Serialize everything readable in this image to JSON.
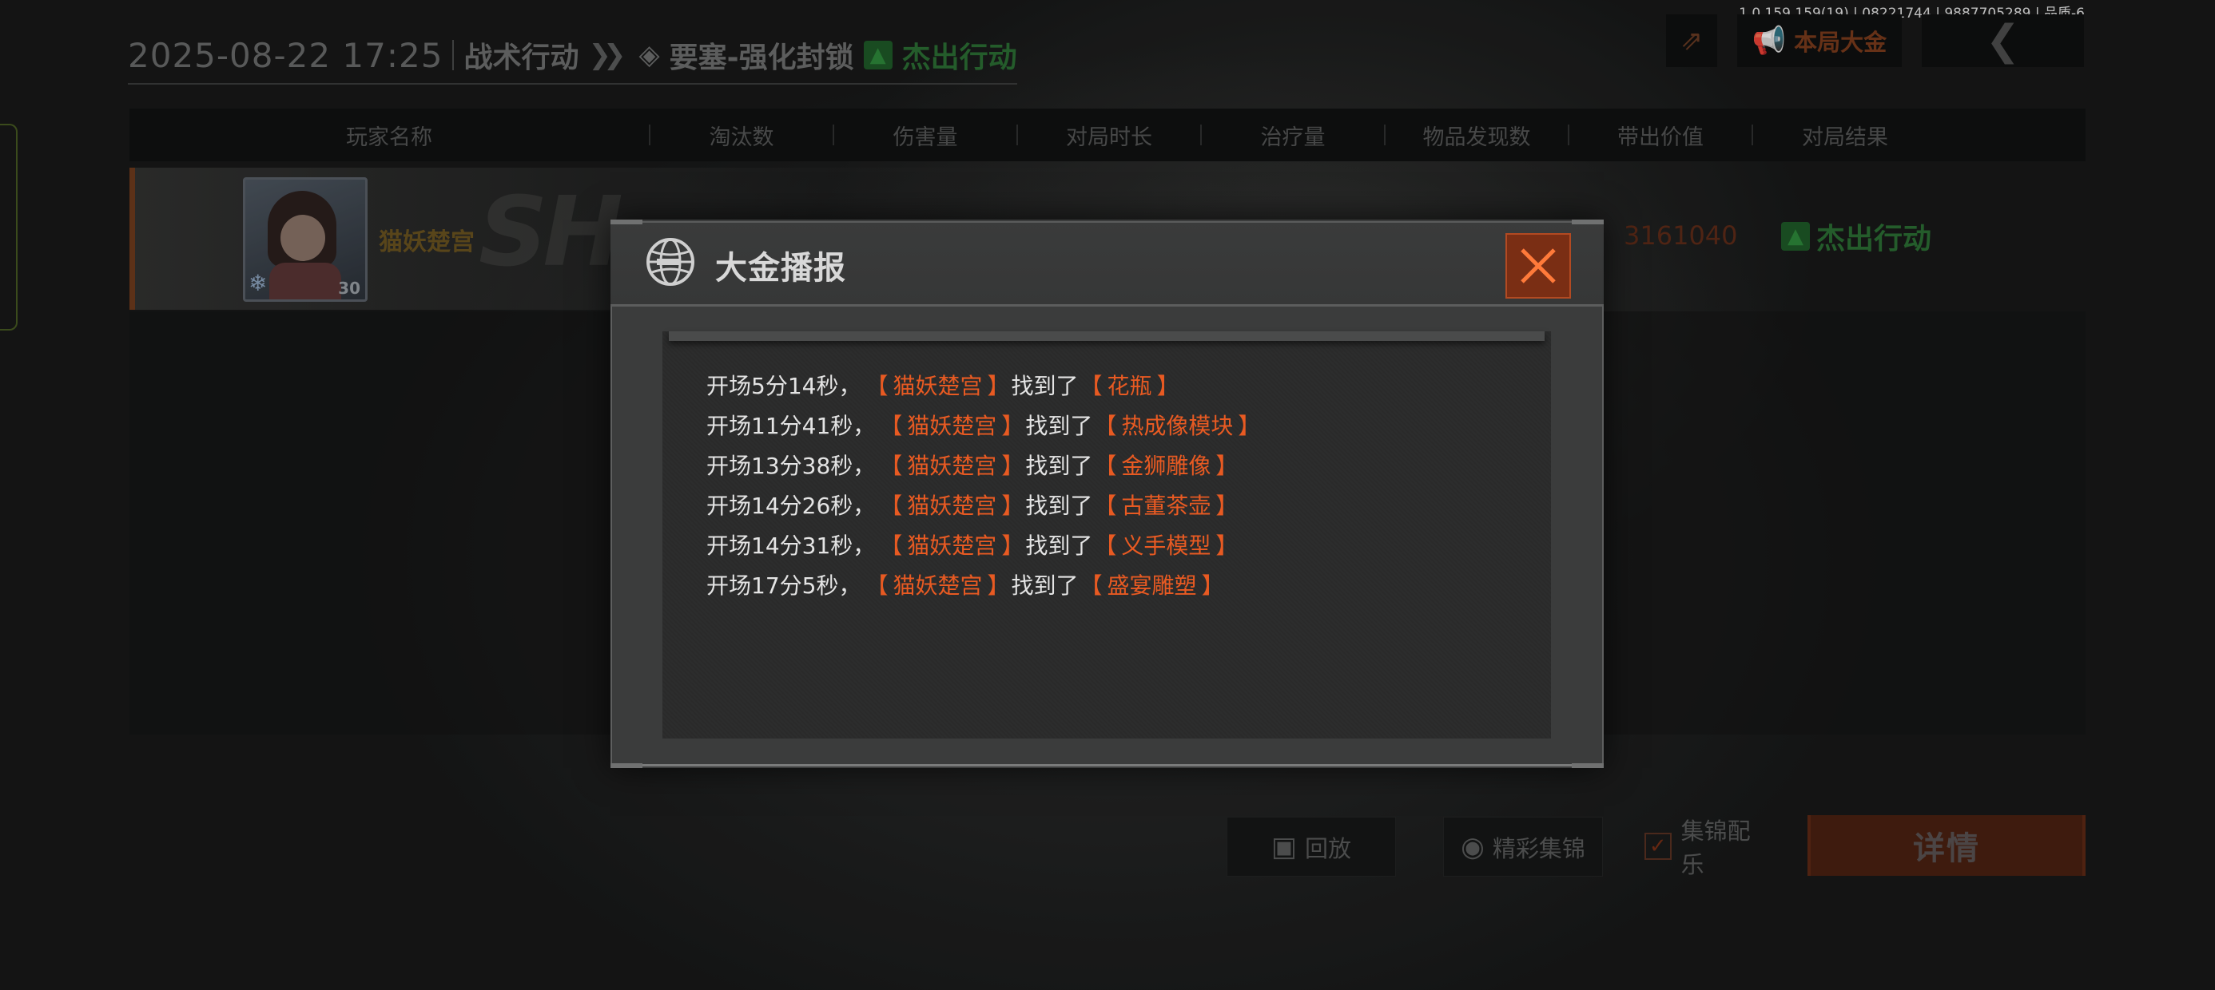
{
  "version_info": "1.0.159.159(19) | 08221744 | 9887705289 | 品质-6",
  "header": {
    "datetime": "2025-08-22 17:25",
    "mode": "战术行动",
    "map": "要塞-强化封锁",
    "result": "杰出行动"
  },
  "top_buttons": {
    "big_money_label": "本局大金"
  },
  "table": {
    "columns": [
      "玩家名称",
      "淘汰数",
      "伤害量",
      "对局时长",
      "治疗量",
      "物品发现数",
      "带出价值",
      "对局结果"
    ]
  },
  "player_row": {
    "name": "猫妖楚宫",
    "level": "30",
    "emblem_text": "SH",
    "value": "3161040",
    "result": "杰出行动"
  },
  "bottom_bar": {
    "replay_label": "回放",
    "highlights_label": "精彩集锦",
    "music_label": "集锦配乐",
    "music_checked": true,
    "details_label": "详情"
  },
  "modal": {
    "title": "大金播报",
    "found_text": "找到了",
    "reports": [
      {
        "time": "开场5分14秒",
        "player": "猫妖楚宫",
        "item": "花瓶"
      },
      {
        "time": "开场11分41秒",
        "player": "猫妖楚宫",
        "item": "热成像模块"
      },
      {
        "time": "开场13分38秒",
        "player": "猫妖楚宫",
        "item": "金狮雕像"
      },
      {
        "time": "开场14分26秒",
        "player": "猫妖楚宫",
        "item": "古董茶壶"
      },
      {
        "time": "开场14分31秒",
        "player": "猫妖楚宫",
        "item": "义手模型"
      },
      {
        "time": "开场17分5秒",
        "player": "猫妖楚宫",
        "item": "盛宴雕塑"
      }
    ]
  },
  "colors": {
    "accent_orange": "#e85a22",
    "close_button": "#7a2e14",
    "success_green": "#2a6e33"
  },
  "icons": {
    "share": "share-icon",
    "megaphone": "megaphone-icon",
    "back": "chevron-left-icon",
    "globe": "globe-icon",
    "close": "close-icon",
    "replay": "video-icon",
    "highlights": "camera-icon",
    "check": "checkmark-icon"
  }
}
